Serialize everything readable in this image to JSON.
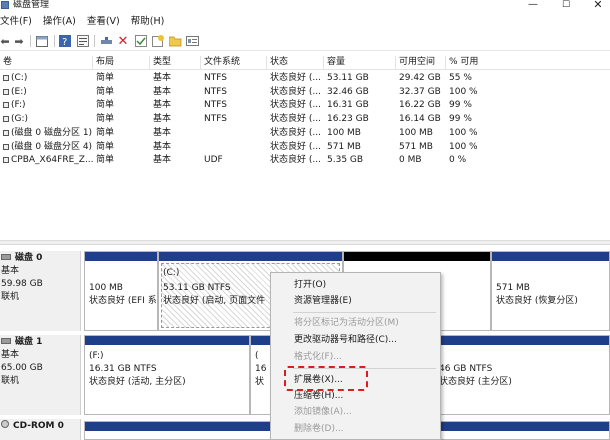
{
  "window": {
    "title": "磁盘管理"
  },
  "menus": [
    "文件(F)",
    "操作(A)",
    "查看(V)",
    "帮助(H)"
  ],
  "toolbar": {
    "icons": [
      "back-icon",
      "forward-icon",
      "properties-icon",
      "help-icon",
      "help-topics-icon",
      "connect-icon",
      "delete-icon",
      "check-icon",
      "new-volume-icon",
      "folder-icon",
      "settings-icon"
    ]
  },
  "columns": [
    "卷",
    "布局",
    "类型",
    "文件系统",
    "状态",
    "容量",
    "可用空间",
    "% 可用"
  ],
  "volumes": [
    {
      "name": "(C:)",
      "layout": "简单",
      "type": "基本",
      "fs": "NTFS",
      "status": "状态良好 (...",
      "capacity": "53.11 GB",
      "free": "29.42 GB",
      "pct": "55 %"
    },
    {
      "name": "(E:)",
      "layout": "简单",
      "type": "基本",
      "fs": "NTFS",
      "status": "状态良好 (...",
      "capacity": "32.46 GB",
      "free": "32.37 GB",
      "pct": "100 %"
    },
    {
      "name": "(F:)",
      "layout": "简单",
      "type": "基本",
      "fs": "NTFS",
      "status": "状态良好 (...",
      "capacity": "16.31 GB",
      "free": "16.22 GB",
      "pct": "99 %"
    },
    {
      "name": "(G:)",
      "layout": "简单",
      "type": "基本",
      "fs": "NTFS",
      "status": "状态良好 (...",
      "capacity": "16.23 GB",
      "free": "16.14 GB",
      "pct": "99 %"
    },
    {
      "name": "(磁盘 0 磁盘分区 1)",
      "layout": "简单",
      "type": "基本",
      "fs": "",
      "status": "状态良好 (...",
      "capacity": "100 MB",
      "free": "100 MB",
      "pct": "100 %"
    },
    {
      "name": "(磁盘 0 磁盘分区 4)",
      "layout": "简单",
      "type": "基本",
      "fs": "",
      "status": "状态良好 (...",
      "capacity": "571 MB",
      "free": "571 MB",
      "pct": "100 %"
    },
    {
      "name": "CPBA_X64FRE_Z...",
      "layout": "简单",
      "type": "基本",
      "fs": "UDF",
      "status": "状态良好 (...",
      "capacity": "5.35 GB",
      "free": "0 MB",
      "pct": "0 %"
    }
  ],
  "disks": [
    {
      "name": "磁盘 0",
      "kind": "基本",
      "size": "59.98 GB",
      "state": "联机",
      "partitions": [
        {
          "title": "",
          "line1": "100 MB",
          "line2": "状态良好 (EFI 系"
        },
        {
          "title": "(C:)",
          "line1": "53.11 GB NTFS",
          "line2": "状态良好 (启动, 页面文件"
        },
        {
          "title": "",
          "line1": "",
          "line2": ""
        },
        {
          "title": "",
          "line1": "571 MB",
          "line2": "状态良好 (恢复分区)"
        }
      ]
    },
    {
      "name": "磁盘 1",
      "kind": "基本",
      "size": "65.00 GB",
      "state": "联机",
      "partitions": [
        {
          "title": "(F:)",
          "line1": "16.31 GB NTFS",
          "line2": "状态良好 (活动, 主分区)"
        },
        {
          "title": "(",
          "line1": "16",
          "line2": "状"
        },
        {
          "title": "",
          "line1": "46 GB NTFS",
          "line2": "状态良好 (主分区)"
        }
      ]
    },
    {
      "name": "CD-ROM 0"
    }
  ],
  "context_menu": {
    "items": [
      {
        "label": "打开(O)",
        "enabled": true
      },
      {
        "label": "资源管理器(E)",
        "enabled": true
      },
      {
        "label": "将分区标记为活动分区(M)",
        "enabled": false
      },
      {
        "label": "更改驱动器号和路径(C)...",
        "enabled": true
      },
      {
        "label": "格式化(F)...",
        "enabled": false
      },
      {
        "label": "扩展卷(X)...",
        "enabled": true
      },
      {
        "label": "压缩卷(H)...",
        "enabled": true
      },
      {
        "label": "添加镜像(A)...",
        "enabled": false
      },
      {
        "label": "删除卷(D)...",
        "enabled": false
      }
    ]
  },
  "colors": {
    "partition_bar": "#1f3e8a",
    "unallocated_bar": "#000000",
    "highlight": "#d81e1e"
  }
}
